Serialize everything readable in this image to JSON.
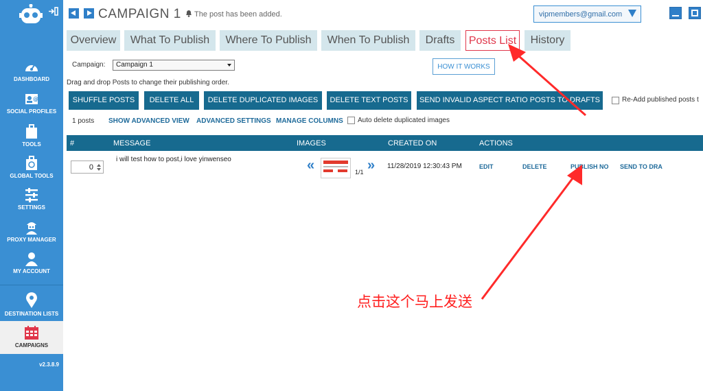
{
  "sidebar": {
    "items": [
      {
        "label": "DASHBOARD",
        "icon": "dashboard-icon"
      },
      {
        "label": "SOCIAL PROFILES",
        "icon": "social-profiles-icon"
      },
      {
        "label": "TOOLS",
        "icon": "tools-icon"
      },
      {
        "label": "GLOBAL TOOLS",
        "icon": "global-tools-icon"
      },
      {
        "label": "SETTINGS",
        "icon": "settings-icon"
      },
      {
        "label": "PROXY MANAGER",
        "icon": "proxy-icon"
      },
      {
        "label": "MY ACCOUNT",
        "icon": "account-icon"
      },
      {
        "label": "DESTINATION LISTS",
        "icon": "map-pin-icon"
      },
      {
        "label": "CAMPAIGNS",
        "icon": "calendar-icon"
      }
    ],
    "version": "v2.3.8.9"
  },
  "header": {
    "title": "CAMPAIGN 1",
    "notice": "The post has been added.",
    "email": "vipmembers@gmail.com"
  },
  "tabs": [
    "Overview",
    "What To Publish",
    "Where To Publish",
    "When To Publish",
    "Drafts",
    "Posts List",
    "History"
  ],
  "active_tab": "Posts List",
  "campaign_select": {
    "label": "Campaign:",
    "value": "Campaign 1"
  },
  "how_it_works": "HOW IT WORKS",
  "hint": "Drag and drop Posts to change their publishing order.",
  "buttons": {
    "shuffle": "SHUFFLE POSTS",
    "delete_all": "DELETE ALL",
    "delete_dup": "DELETE DUPLICATED IMAGES",
    "delete_text": "DELETE TEXT POSTS",
    "send_invalid": "SEND INVALID ASPECT RATIO POSTS TO DRAFTS"
  },
  "readd_label": "Re-Add published posts t",
  "toolbar": {
    "count": "1 posts",
    "show_advanced": "SHOW ADVANCED VIEW",
    "advanced_settings": "ADVANCED SETTINGS",
    "manage_columns": "MANAGE COLUMNS",
    "auto_delete": "Auto delete duplicated images"
  },
  "table": {
    "headers": [
      "#",
      "MESSAGE",
      "IMAGES",
      "CREATED ON",
      "ACTIONS"
    ],
    "rows": [
      {
        "order": "0",
        "message": "i will test how to post,i love yinwenseo",
        "image_count": "1/1",
        "created": "11/28/2019 12:30:43 PM",
        "actions": [
          "EDIT",
          "DELETE",
          "PUBLISH NO",
          "SEND TO DRA"
        ]
      }
    ]
  },
  "annotation": "点击这个马上发送",
  "colors": {
    "sidebar": "#3a8fd3",
    "primary": "#176a8f",
    "active_tab": "#e0364a",
    "annotation": "#ff1e1e"
  }
}
